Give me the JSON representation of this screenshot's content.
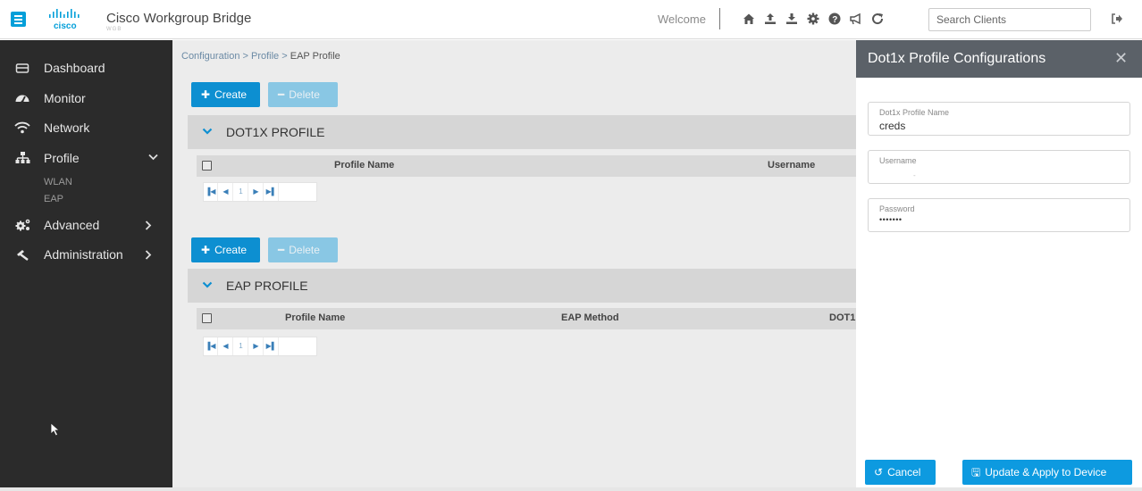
{
  "header": {
    "app_title": "Cisco Workgroup Bridge",
    "app_subtitle": "WGB",
    "logo_text": "cisco",
    "welcome": "Welcome",
    "search_placeholder": "Search Clients",
    "icons": [
      "home-icon",
      "upload-icon",
      "download-icon",
      "settings-icon",
      "help-icon",
      "announce-icon",
      "refresh-icon",
      "logout-icon"
    ]
  },
  "sidebar": {
    "items": [
      {
        "label": "Dashboard",
        "icon": "dashboard-icon"
      },
      {
        "label": "Monitor",
        "icon": "monitor-icon"
      },
      {
        "label": "Network",
        "icon": "wifi-icon"
      },
      {
        "label": "Profile",
        "icon": "sitemap-icon",
        "expanded": true,
        "children": [
          "WLAN",
          "EAP"
        ]
      },
      {
        "label": "Advanced",
        "icon": "cogs-icon"
      },
      {
        "label": "Administration",
        "icon": "gavel-icon"
      }
    ]
  },
  "breadcrumb": {
    "items": [
      "Configuration",
      "Profile",
      "EAP Profile"
    ],
    "separator": ">"
  },
  "dot1x_section": {
    "create_label": "Create",
    "delete_label": "Delete",
    "title": "DOT1X PROFILE",
    "columns": [
      "Profile Name",
      "Username"
    ],
    "page": "1"
  },
  "eap_section": {
    "create_label": "Create",
    "delete_label": "Delete",
    "title": "EAP PROFILE",
    "columns": [
      "Profile Name",
      "EAP Method",
      "DOT1"
    ],
    "page": "1"
  },
  "panel": {
    "title": "Dot1x Profile Configurations",
    "fields": [
      {
        "label": "Dot1x Profile Name",
        "value": "creds"
      },
      {
        "label": "Username",
        "value": "",
        "placeholder": "-"
      },
      {
        "label": "Password",
        "value": "•••••••"
      }
    ],
    "cancel_label": "Cancel",
    "update_label": "Update & Apply to Device"
  },
  "colors": {
    "accent": "#0d9ae0",
    "sidebar_bg": "#2b2b2b",
    "panel_header_bg": "#5b6168"
  }
}
